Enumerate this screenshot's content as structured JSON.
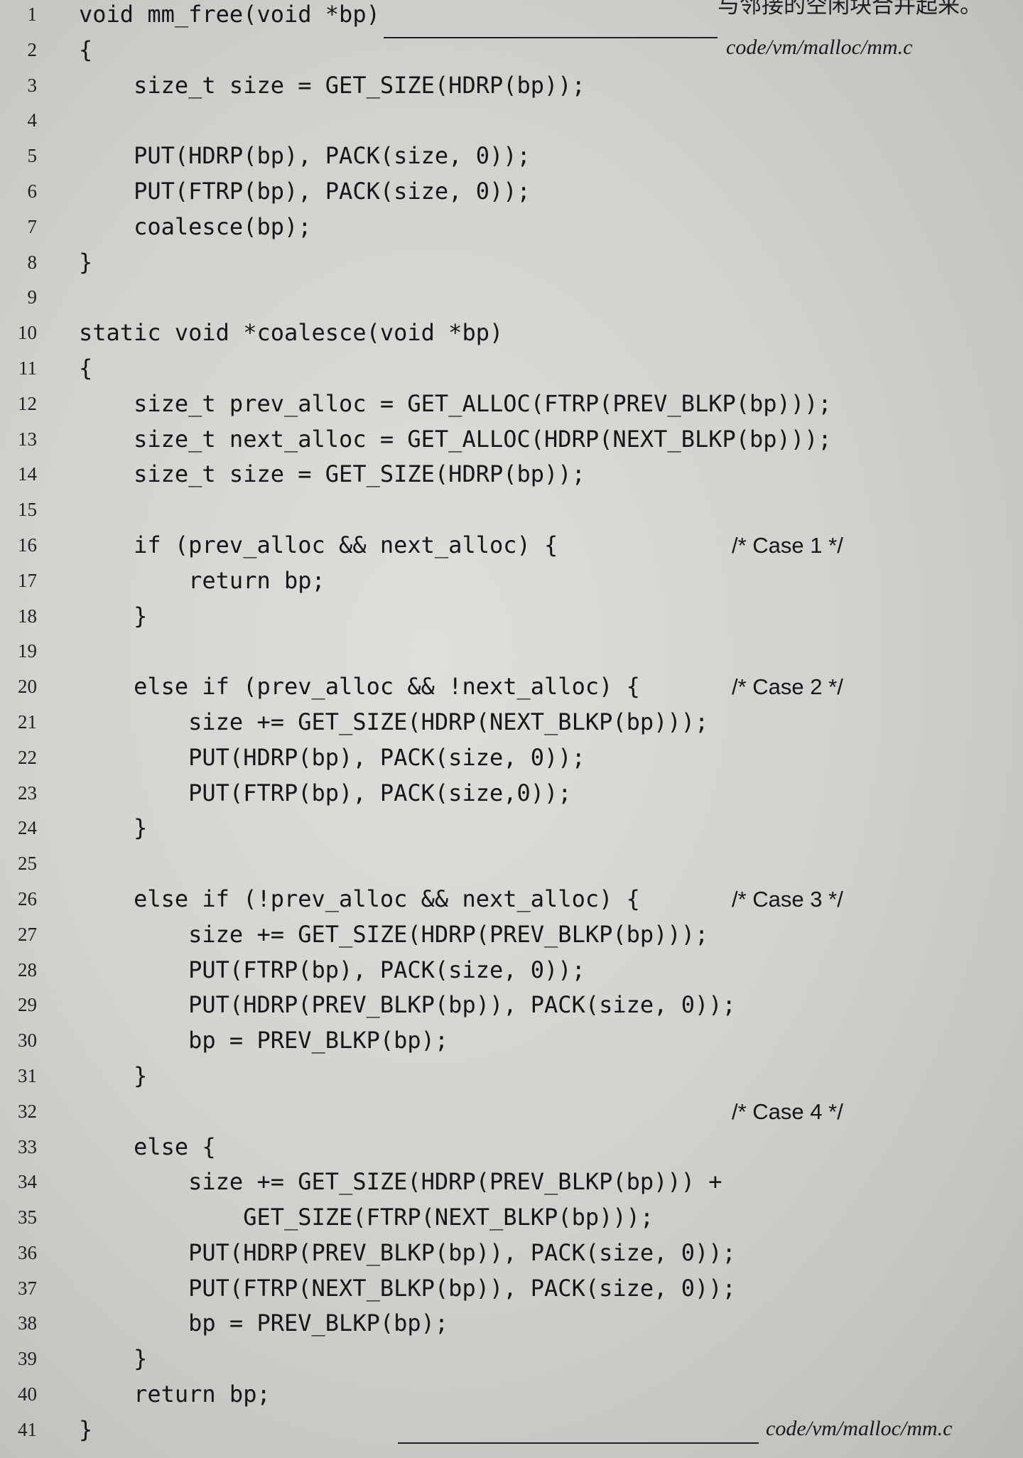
{
  "page": {
    "top_fragment": "与邻接的空闲块合并起来。",
    "file_label_top": "code/vm/malloc/mm.c",
    "file_label_bottom": "code/vm/malloc/mm.c"
  },
  "colors": {
    "paper": "#d1d1cd",
    "ink": "#1a1a1a"
  },
  "code_lines": [
    {
      "n": "1",
      "code": "void mm_free(void *bp)"
    },
    {
      "n": "2",
      "code": "{"
    },
    {
      "n": "3",
      "code": "    size_t size = GET_SIZE(HDRP(bp));"
    },
    {
      "n": "4"
    },
    {
      "n": "5",
      "code": "    PUT(HDRP(bp), PACK(size, 0));"
    },
    {
      "n": "6",
      "code": "    PUT(FTRP(bp), PACK(size, 0));"
    },
    {
      "n": "7",
      "code": "    coalesce(bp);"
    },
    {
      "n": "8",
      "code": "}"
    },
    {
      "n": "9"
    },
    {
      "n": "10",
      "code": "static void *coalesce(void *bp)"
    },
    {
      "n": "11",
      "code": "{"
    },
    {
      "n": "12",
      "code": "    size_t prev_alloc = GET_ALLOC(FTRP(PREV_BLKP(bp)));"
    },
    {
      "n": "13",
      "code": "    size_t next_alloc = GET_ALLOC(HDRP(NEXT_BLKP(bp)));"
    },
    {
      "n": "14",
      "code": "    size_t size = GET_SIZE(HDRP(bp));"
    },
    {
      "n": "15"
    },
    {
      "n": "16",
      "code": "    if (prev_alloc && next_alloc) {",
      "comment": "/* Case 1 */"
    },
    {
      "n": "17",
      "code": "        return bp;"
    },
    {
      "n": "18",
      "code": "    }"
    },
    {
      "n": "19"
    },
    {
      "n": "20",
      "code": "    else if (prev_alloc && !next_alloc) {",
      "comment": "/* Case 2 */"
    },
    {
      "n": "21",
      "code": "        size += GET_SIZE(HDRP(NEXT_BLKP(bp)));"
    },
    {
      "n": "22",
      "code": "        PUT(HDRP(bp), PACK(size, 0));"
    },
    {
      "n": "23",
      "code": "        PUT(FTRP(bp), PACK(size,0));"
    },
    {
      "n": "24",
      "code": "    }"
    },
    {
      "n": "25"
    },
    {
      "n": "26",
      "code": "    else if (!prev_alloc && next_alloc) {",
      "comment": "/* Case 3 */"
    },
    {
      "n": "27",
      "code": "        size += GET_SIZE(HDRP(PREV_BLKP(bp)));"
    },
    {
      "n": "28",
      "code": "        PUT(FTRP(bp), PACK(size, 0));"
    },
    {
      "n": "29",
      "code": "        PUT(HDRP(PREV_BLKP(bp)), PACK(size, 0));"
    },
    {
      "n": "30",
      "code": "        bp = PREV_BLKP(bp);"
    },
    {
      "n": "31",
      "code": "    }"
    },
    {
      "n": "32",
      "comment": "/* Case 4 */"
    },
    {
      "n": "33",
      "code": "    else {"
    },
    {
      "n": "34",
      "code": "        size += GET_SIZE(HDRP(PREV_BLKP(bp))) +"
    },
    {
      "n": "35",
      "code": "            GET_SIZE(FTRP(NEXT_BLKP(bp)));"
    },
    {
      "n": "36",
      "code": "        PUT(HDRP(PREV_BLKP(bp)), PACK(size, 0));"
    },
    {
      "n": "37",
      "code": "        PUT(FTRP(NEXT_BLKP(bp)), PACK(size, 0));"
    },
    {
      "n": "38",
      "code": "        bp = PREV_BLKP(bp);"
    },
    {
      "n": "39",
      "code": "    }"
    },
    {
      "n": "40",
      "code": "    return bp;"
    },
    {
      "n": "41",
      "code": "}"
    }
  ]
}
